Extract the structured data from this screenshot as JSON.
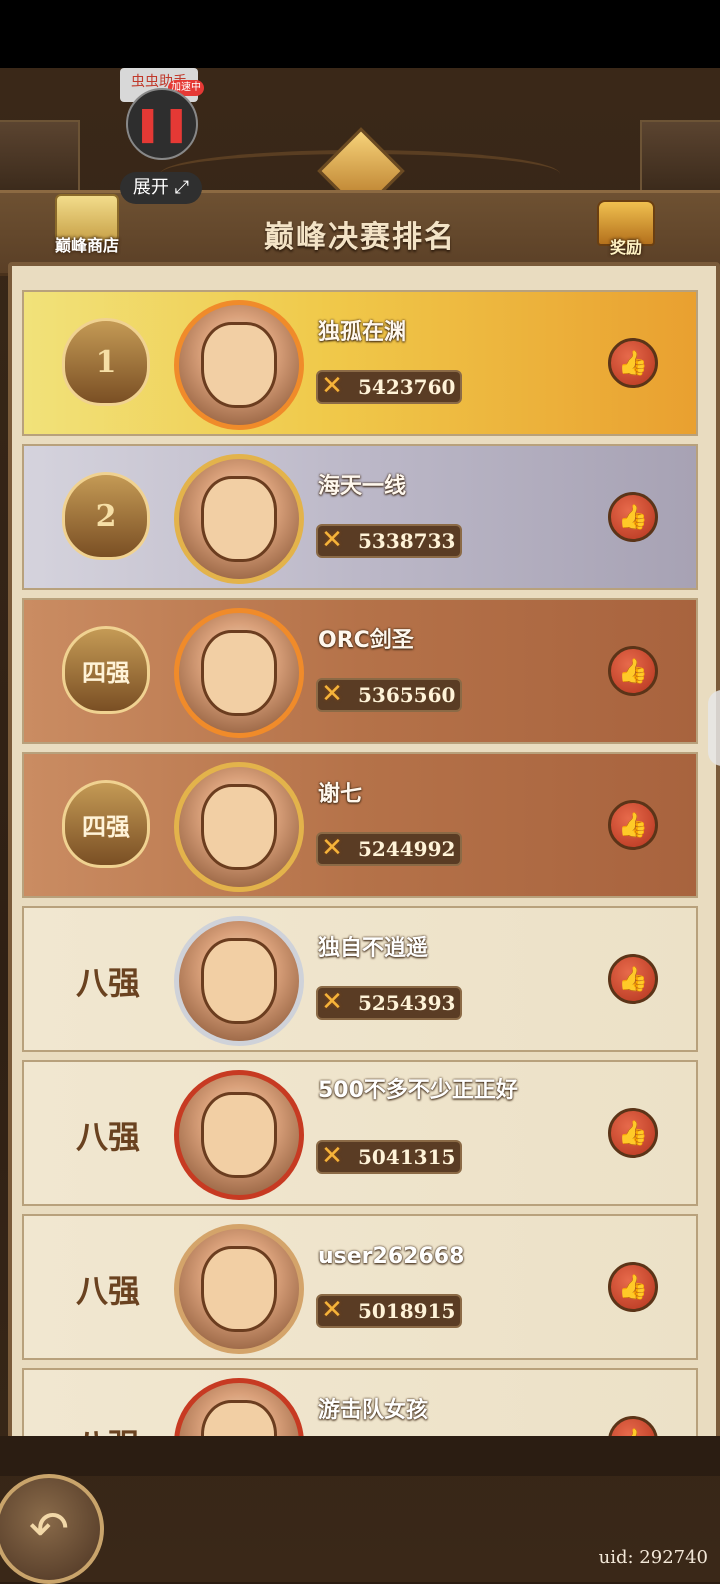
{
  "header": {
    "title": "巅峰决赛排名",
    "shop_label": "巅峰商店",
    "reward_label": "奖励"
  },
  "overlay": {
    "helper_label": "虫虫助手",
    "helper_badge": "加速中",
    "pause_icon": "pause-icon",
    "expand_label": "展开"
  },
  "ranking": [
    {
      "rank": "1",
      "tier": "gold",
      "name": "独孤在渊",
      "score": "5423760"
    },
    {
      "rank": "2",
      "tier": "silver",
      "name": "海天一线",
      "score": "5338733"
    },
    {
      "rank": "四强",
      "tier": "bronze",
      "name": "ORC剑圣",
      "score": "5365560"
    },
    {
      "rank": "四强",
      "tier": "bronze",
      "name": "谢七",
      "score": "5244992"
    },
    {
      "rank": "八强",
      "tier": "plain",
      "name": "独自不逍遥",
      "score": "5254393"
    },
    {
      "rank": "八强",
      "tier": "plain",
      "name": "500不多不少正正好",
      "score": "5041315"
    },
    {
      "rank": "八强",
      "tier": "plain",
      "name": "user262668",
      "score": "5018915"
    },
    {
      "rank": "八强",
      "tier": "plain",
      "name": "游击队女孩",
      "score": ""
    }
  ],
  "footer": {
    "uid_text": "uid: 292740"
  },
  "icons": {
    "like": "thumbs-up-icon",
    "score": "crossed-swords-icon",
    "back": "back-arrow-icon"
  }
}
